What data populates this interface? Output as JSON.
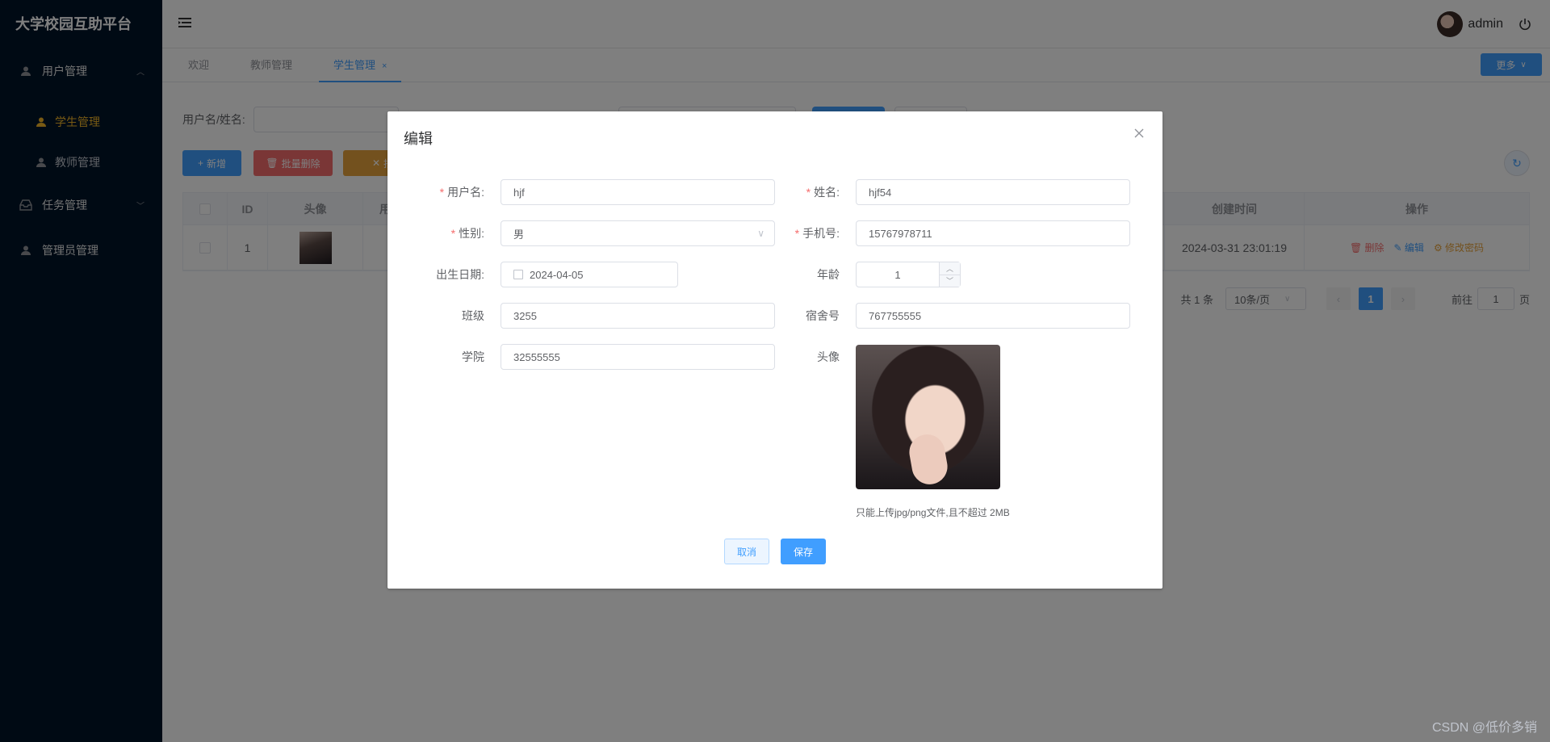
{
  "app_title": "大学校园互助平台",
  "sidebar": {
    "items": [
      {
        "label": "用户管理",
        "icon": "user-icon"
      },
      {
        "label": "学生管理",
        "icon": "user-icon",
        "active": true
      },
      {
        "label": "教师管理",
        "icon": "user-icon"
      },
      {
        "label": "任务管理",
        "icon": "inbox-icon"
      },
      {
        "label": "管理员管理",
        "icon": "user-icon"
      }
    ]
  },
  "header": {
    "user": "admin"
  },
  "tags": [
    {
      "label": "欢迎"
    },
    {
      "label": "教师管理"
    },
    {
      "label": "学生管理",
      "close": "×"
    }
  ],
  "more_label": "更多",
  "search": {
    "label": "用户名/姓名:"
  },
  "toolbar": {
    "add": "新增",
    "batch_delete": "批量删除",
    "batch_import": "批"
  },
  "table": {
    "headers": [
      "ID",
      "头像",
      "用",
      "创建时间",
      "操作"
    ],
    "rows": [
      {
        "id": "1",
        "created": "2024-03-31 23:01:19"
      }
    ],
    "ops": {
      "delete": "删除",
      "edit": "编辑",
      "reset": "修改密码"
    }
  },
  "pagination": {
    "total": "共 1 条",
    "page_size": "10条/页",
    "current": "1",
    "goto": "前往",
    "goto_value": "1",
    "page_unit": "页"
  },
  "dialog": {
    "title": "编辑",
    "fields": {
      "username": {
        "label": "用户名:",
        "value": "hjf"
      },
      "name": {
        "label": "姓名:",
        "value": "hjf54"
      },
      "gender": {
        "label": "性别:",
        "value": "男"
      },
      "phone": {
        "label": "手机号:",
        "value": "15767978711"
      },
      "birthday": {
        "label": "出生日期:",
        "value": "2024-04-05"
      },
      "age": {
        "label": "年龄",
        "value": "1"
      },
      "class": {
        "label": "班级",
        "value": "3255"
      },
      "dorm": {
        "label": "宿舍号",
        "value": "767755555"
      },
      "college": {
        "label": "学院",
        "value": "32555555"
      },
      "avatar": {
        "label": "头像"
      }
    },
    "upload_tip": "只能上传jpg/png文件,且不超过 2MB",
    "cancel": "取消",
    "save": "保存"
  },
  "watermark": "CSDN @低价多销",
  "colors": {
    "primary": "#409eff",
    "danger": "#f56c6c",
    "warning": "#e6a23c",
    "sidebar_bg": "#001529",
    "active_menu": "#f0b429"
  }
}
